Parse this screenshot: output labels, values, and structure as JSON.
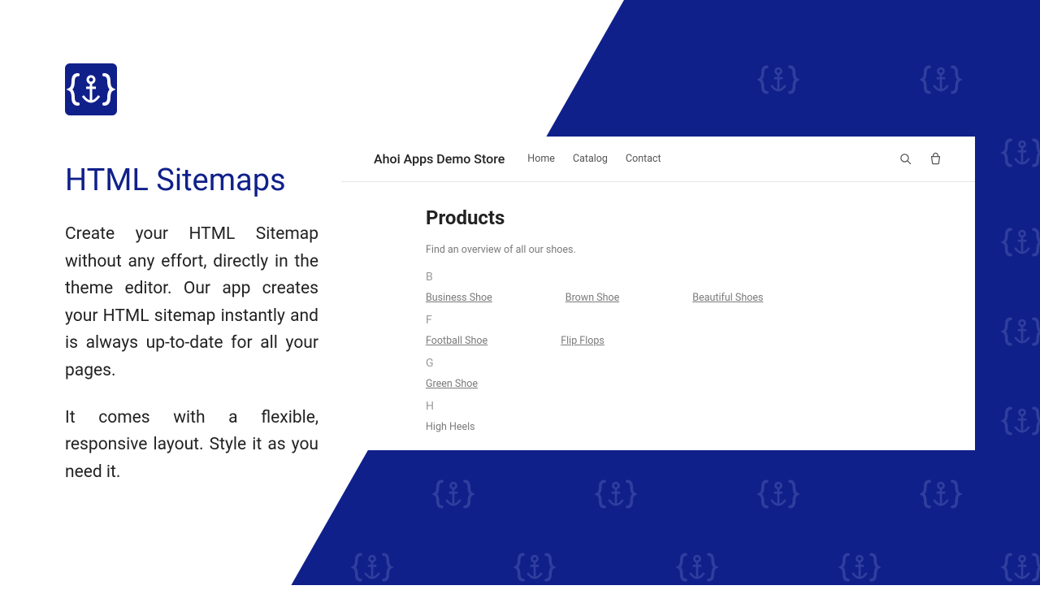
{
  "left": {
    "heading": "HTML Sitemaps",
    "p1": "Create your HTML Sitemap without any effort, directly in the theme editor. Our app creates your HTML sitemap instantly and is always up-to-date for all your pages.",
    "p2": "It comes with a flexible, responsive layout. Style it as you need it."
  },
  "store": {
    "title": "Ahoi Apps Demo Store",
    "nav": {
      "home": "Home",
      "catalog": "Catalog",
      "contact": "Contact"
    },
    "body": {
      "heading": "Products",
      "subtitle": "Find an overview of all our shoes.",
      "groups": {
        "b": {
          "head": "B",
          "items": [
            "Business Shoe",
            "Brown Shoe",
            "Beautiful Shoes"
          ]
        },
        "f": {
          "head": "F",
          "items": [
            "Football Shoe",
            "Flip Flops"
          ]
        },
        "g": {
          "head": "G",
          "items": [
            "Green Shoe"
          ]
        },
        "h": {
          "head": "H",
          "items": [
            "High Heels"
          ]
        }
      }
    }
  },
  "icons": {
    "logo": "anchor-braces-icon",
    "search": "search-icon",
    "cart": "cart-icon"
  }
}
